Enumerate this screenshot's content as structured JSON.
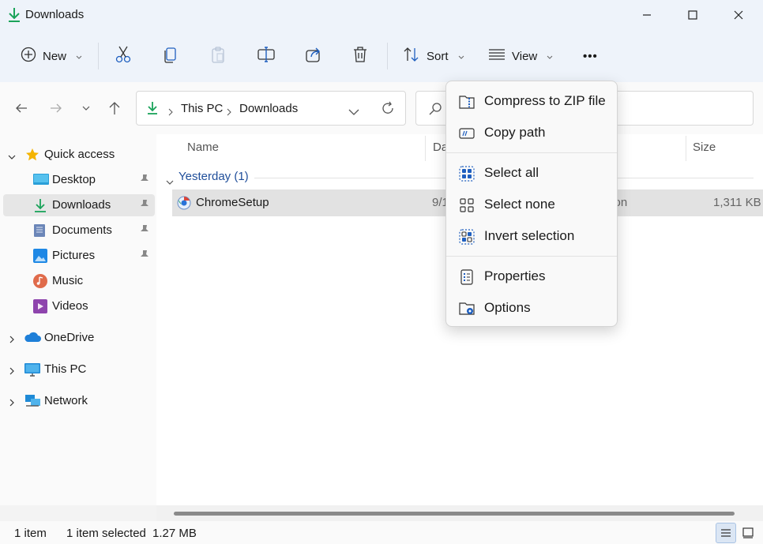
{
  "window": {
    "title": "Downloads"
  },
  "toolbar": {
    "new_label": "New",
    "sort_label": "Sort",
    "view_label": "View",
    "more_label": "•••"
  },
  "address": {
    "crumbs": [
      "This PC",
      "Downloads"
    ]
  },
  "sidebar": {
    "items": [
      {
        "label": "Quick access",
        "icon": "star-icon"
      },
      {
        "label": "Desktop",
        "icon": "desktop-icon"
      },
      {
        "label": "Downloads",
        "icon": "download-icon"
      },
      {
        "label": "Documents",
        "icon": "documents-icon"
      },
      {
        "label": "Pictures",
        "icon": "pictures-icon"
      },
      {
        "label": "Music",
        "icon": "music-icon"
      },
      {
        "label": "Videos",
        "icon": "videos-icon"
      },
      {
        "label": "OneDrive",
        "icon": "cloud-icon"
      },
      {
        "label": "This PC",
        "icon": "monitor-icon"
      },
      {
        "label": "Network",
        "icon": "network-icon"
      }
    ]
  },
  "list": {
    "headers": {
      "name": "Name",
      "date": "Da",
      "size": "Size"
    },
    "group": "Yesterday (1)",
    "rows": [
      {
        "name": "ChromeSetup",
        "date": "9/1",
        "type": "tion",
        "size": "1,311 KB"
      }
    ]
  },
  "menu": {
    "items": [
      {
        "label": "Compress to ZIP file",
        "icon": "zip-icon"
      },
      {
        "label": "Copy path",
        "icon": "copy-path-icon"
      },
      {
        "label": "Select all",
        "icon": "select-all-icon"
      },
      {
        "label": "Select none",
        "icon": "select-none-icon"
      },
      {
        "label": "Invert selection",
        "icon": "invert-selection-icon"
      },
      {
        "label": "Properties",
        "icon": "properties-icon"
      },
      {
        "label": "Options",
        "icon": "options-icon"
      }
    ]
  },
  "status": {
    "count": "1 item",
    "selected": "1 item selected",
    "size": "1.27 MB"
  },
  "colors": {
    "accent": "#0f6cbd",
    "download_green": "#1aa35a",
    "folder_blue": "#3a8ee6"
  }
}
